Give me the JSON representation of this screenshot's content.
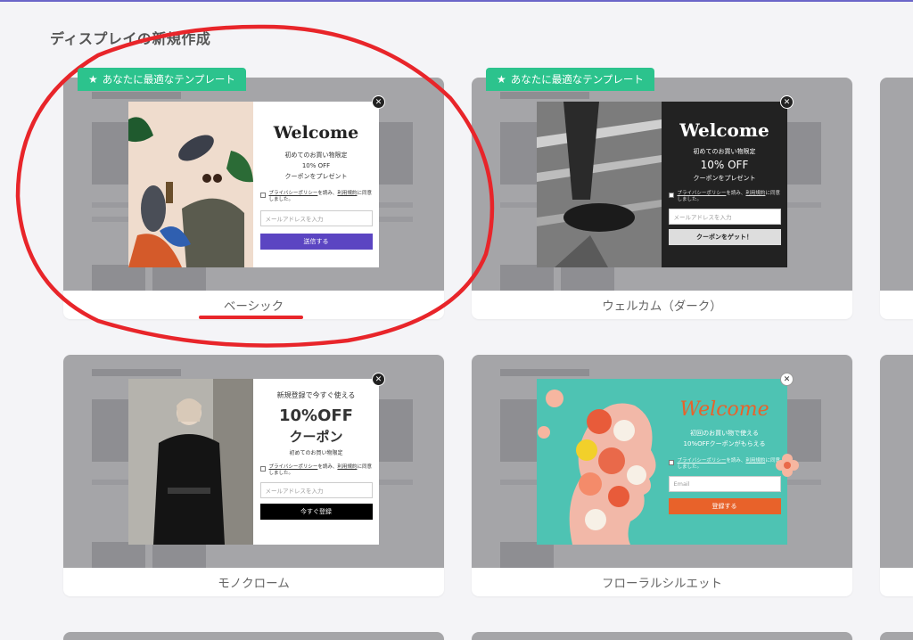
{
  "page": {
    "title": "ディスプレイの新規作成"
  },
  "badge": {
    "label": "あなたに最適なテンプレート"
  },
  "templates": [
    {
      "name": "ベーシック",
      "popup": {
        "heading": "Welcome",
        "line1": "初めてのお買い物限定",
        "line2": "10% OFF",
        "line3": "クーポンをプレゼント",
        "consent_link1": "プライバシーポリシー",
        "consent_mid": "を読み、",
        "consent_link2": "利用規約",
        "consent_end": "に同意しました。",
        "email_placeholder": "メールアドレスを入力",
        "submit_label": "送信する"
      }
    },
    {
      "name": "ウェルカム（ダーク）",
      "popup": {
        "heading": "Welcome",
        "line1": "初めてのお買い物限定",
        "line2": "10% OFF",
        "line3": "クーポンをプレゼント",
        "consent_link1": "プライバシーポリシー",
        "consent_mid": "を読み、",
        "consent_link2": "利用規約",
        "consent_end": "に同意しました。",
        "email_placeholder": "メールアドレスを入力",
        "submit_label": "クーポンをゲット！"
      }
    },
    {
      "name": "モノクローム",
      "popup": {
        "line0": "新規登録で今すぐ使える",
        "line1": "10%OFF",
        "line2": "クーポン",
        "line3": "初めてのお買い物限定",
        "consent_link1": "プライバシーポリシー",
        "consent_mid": "を読み、",
        "consent_link2": "利用規約",
        "consent_end": "に同意しました。",
        "email_placeholder": "メールアドレスを入力",
        "submit_label": "今すぐ登録"
      }
    },
    {
      "name": "フローラルシルエット",
      "popup": {
        "heading": "Welcome",
        "line1": "初回のお買い物で使える",
        "line2": "10%OFFクーポンがもらえる",
        "consent_link1": "プライバシーポリシー",
        "consent_mid": "を読み、",
        "consent_link2": "利用規約",
        "consent_end": "に同意しました。",
        "email_placeholder": "Email",
        "submit_label": "登録する"
      }
    }
  ],
  "colors": {
    "accent_purple": "#5b45c2",
    "badge_green": "#2cc38d",
    "floral_orange": "#e8622a",
    "floral_teal": "#4ec3b3",
    "annotation_red": "#e8252a"
  },
  "icons": {
    "badge": "star-icon",
    "close": "close-icon"
  }
}
